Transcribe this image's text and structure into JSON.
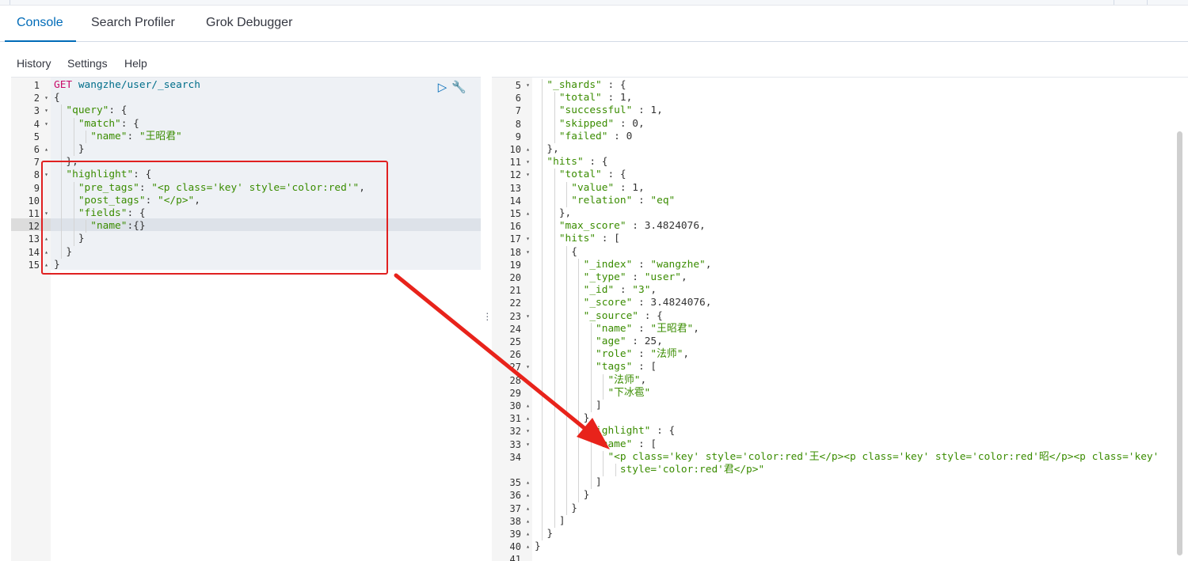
{
  "tabs": [
    {
      "label": "Console",
      "active": true
    },
    {
      "label": "Search Profiler",
      "active": false
    },
    {
      "label": "Grok Debugger",
      "active": false
    }
  ],
  "menu": [
    {
      "label": "History"
    },
    {
      "label": "Settings"
    },
    {
      "label": "Help"
    }
  ],
  "actions": {
    "run_icon": "play-icon",
    "settings_icon": "wrench-icon"
  },
  "colors": {
    "accent": "#006bb8",
    "annotation": "#e02020",
    "string": "#3a8c00",
    "method": "#c80a68"
  },
  "request": {
    "lines": [
      {
        "n": "1",
        "fold": "",
        "tokens": [
          {
            "t": "GET",
            "c": "method"
          },
          {
            "t": " ",
            "c": "p"
          },
          {
            "t": "wangzhe/user/_search",
            "c": "url"
          }
        ]
      },
      {
        "n": "2",
        "fold": "▾",
        "tokens": [
          {
            "t": "{",
            "c": "p"
          }
        ]
      },
      {
        "n": "3",
        "fold": "▾",
        "tokens": [
          {
            "t": "  ",
            "c": "p"
          },
          {
            "t": "\"query\"",
            "c": "key"
          },
          {
            "t": ": {",
            "c": "p"
          }
        ]
      },
      {
        "n": "4",
        "fold": "▾",
        "tokens": [
          {
            "t": "    ",
            "c": "p"
          },
          {
            "t": "\"match\"",
            "c": "key"
          },
          {
            "t": ": {",
            "c": "p"
          }
        ]
      },
      {
        "n": "5",
        "fold": "",
        "tokens": [
          {
            "t": "      ",
            "c": "p"
          },
          {
            "t": "\"name\"",
            "c": "key"
          },
          {
            "t": ": ",
            "c": "p"
          },
          {
            "t": "\"王昭君\"",
            "c": "str"
          }
        ]
      },
      {
        "n": "6",
        "fold": "▴",
        "tokens": [
          {
            "t": "    }",
            "c": "p"
          }
        ]
      },
      {
        "n": "7",
        "fold": "",
        "tokens": [
          {
            "t": "  },",
            "c": "p"
          }
        ]
      },
      {
        "n": "8",
        "fold": "▾",
        "tokens": [
          {
            "t": "  ",
            "c": "p"
          },
          {
            "t": "\"highlight\"",
            "c": "key"
          },
          {
            "t": ": {",
            "c": "p"
          }
        ]
      },
      {
        "n": "9",
        "fold": "",
        "tokens": [
          {
            "t": "    ",
            "c": "p"
          },
          {
            "t": "\"pre_tags\"",
            "c": "key"
          },
          {
            "t": ": ",
            "c": "p"
          },
          {
            "t": "\"<p class='key' style='color:red'\"",
            "c": "str"
          },
          {
            "t": ",",
            "c": "p"
          }
        ]
      },
      {
        "n": "10",
        "fold": "",
        "tokens": [
          {
            "t": "    ",
            "c": "p"
          },
          {
            "t": "\"post_tags\"",
            "c": "key"
          },
          {
            "t": ": ",
            "c": "p"
          },
          {
            "t": "\"</p>\"",
            "c": "str"
          },
          {
            "t": ",",
            "c": "p"
          }
        ]
      },
      {
        "n": "11",
        "fold": "▾",
        "tokens": [
          {
            "t": "    ",
            "c": "p"
          },
          {
            "t": "\"fields\"",
            "c": "key"
          },
          {
            "t": ": {",
            "c": "p"
          }
        ]
      },
      {
        "n": "12",
        "fold": "",
        "tokens": [
          {
            "t": "      ",
            "c": "p"
          },
          {
            "t": "\"name\"",
            "c": "key"
          },
          {
            "t": ":{}",
            "c": "p"
          }
        ]
      },
      {
        "n": "13",
        "fold": "▴",
        "tokens": [
          {
            "t": "    }",
            "c": "p"
          }
        ]
      },
      {
        "n": "14",
        "fold": "▴",
        "tokens": [
          {
            "t": "  }",
            "c": "p"
          }
        ]
      },
      {
        "n": "15",
        "fold": "▴",
        "tokens": [
          {
            "t": "}",
            "c": "p"
          }
        ]
      }
    ]
  },
  "response": {
    "lines": [
      {
        "n": "5",
        "fold": "▾",
        "tokens": [
          {
            "t": "  ",
            "c": "p"
          },
          {
            "t": "\"_shards\"",
            "c": "key"
          },
          {
            "t": " : {",
            "c": "p"
          }
        ]
      },
      {
        "n": "6",
        "fold": "",
        "tokens": [
          {
            "t": "    ",
            "c": "p"
          },
          {
            "t": "\"total\"",
            "c": "key"
          },
          {
            "t": " : 1,",
            "c": "p"
          }
        ]
      },
      {
        "n": "7",
        "fold": "",
        "tokens": [
          {
            "t": "    ",
            "c": "p"
          },
          {
            "t": "\"successful\"",
            "c": "key"
          },
          {
            "t": " : 1,",
            "c": "p"
          }
        ]
      },
      {
        "n": "8",
        "fold": "",
        "tokens": [
          {
            "t": "    ",
            "c": "p"
          },
          {
            "t": "\"skipped\"",
            "c": "key"
          },
          {
            "t": " : 0,",
            "c": "p"
          }
        ]
      },
      {
        "n": "9",
        "fold": "",
        "tokens": [
          {
            "t": "    ",
            "c": "p"
          },
          {
            "t": "\"failed\"",
            "c": "key"
          },
          {
            "t": " : 0",
            "c": "p"
          }
        ]
      },
      {
        "n": "10",
        "fold": "▴",
        "tokens": [
          {
            "t": "  },",
            "c": "p"
          }
        ]
      },
      {
        "n": "11",
        "fold": "▾",
        "tokens": [
          {
            "t": "  ",
            "c": "p"
          },
          {
            "t": "\"hits\"",
            "c": "key"
          },
          {
            "t": " : {",
            "c": "p"
          }
        ]
      },
      {
        "n": "12",
        "fold": "▾",
        "tokens": [
          {
            "t": "    ",
            "c": "p"
          },
          {
            "t": "\"total\"",
            "c": "key"
          },
          {
            "t": " : {",
            "c": "p"
          }
        ]
      },
      {
        "n": "13",
        "fold": "",
        "tokens": [
          {
            "t": "      ",
            "c": "p"
          },
          {
            "t": "\"value\"",
            "c": "key"
          },
          {
            "t": " : 1,",
            "c": "p"
          }
        ]
      },
      {
        "n": "14",
        "fold": "",
        "tokens": [
          {
            "t": "      ",
            "c": "p"
          },
          {
            "t": "\"relation\"",
            "c": "key"
          },
          {
            "t": " : ",
            "c": "p"
          },
          {
            "t": "\"eq\"",
            "c": "str"
          }
        ]
      },
      {
        "n": "15",
        "fold": "▴",
        "tokens": [
          {
            "t": "    },",
            "c": "p"
          }
        ]
      },
      {
        "n": "16",
        "fold": "",
        "tokens": [
          {
            "t": "    ",
            "c": "p"
          },
          {
            "t": "\"max_score\"",
            "c": "key"
          },
          {
            "t": " : 3.4824076,",
            "c": "p"
          }
        ]
      },
      {
        "n": "17",
        "fold": "▾",
        "tokens": [
          {
            "t": "    ",
            "c": "p"
          },
          {
            "t": "\"hits\"",
            "c": "key"
          },
          {
            "t": " : [",
            "c": "p"
          }
        ]
      },
      {
        "n": "18",
        "fold": "▾",
        "tokens": [
          {
            "t": "      {",
            "c": "p"
          }
        ]
      },
      {
        "n": "19",
        "fold": "",
        "tokens": [
          {
            "t": "        ",
            "c": "p"
          },
          {
            "t": "\"_index\"",
            "c": "key"
          },
          {
            "t": " : ",
            "c": "p"
          },
          {
            "t": "\"wangzhe\"",
            "c": "str"
          },
          {
            "t": ",",
            "c": "p"
          }
        ]
      },
      {
        "n": "20",
        "fold": "",
        "tokens": [
          {
            "t": "        ",
            "c": "p"
          },
          {
            "t": "\"_type\"",
            "c": "key"
          },
          {
            "t": " : ",
            "c": "p"
          },
          {
            "t": "\"user\"",
            "c": "str"
          },
          {
            "t": ",",
            "c": "p"
          }
        ]
      },
      {
        "n": "21",
        "fold": "",
        "tokens": [
          {
            "t": "        ",
            "c": "p"
          },
          {
            "t": "\"_id\"",
            "c": "key"
          },
          {
            "t": " : ",
            "c": "p"
          },
          {
            "t": "\"3\"",
            "c": "str"
          },
          {
            "t": ",",
            "c": "p"
          }
        ]
      },
      {
        "n": "22",
        "fold": "",
        "tokens": [
          {
            "t": "        ",
            "c": "p"
          },
          {
            "t": "\"_score\"",
            "c": "key"
          },
          {
            "t": " : 3.4824076,",
            "c": "p"
          }
        ]
      },
      {
        "n": "23",
        "fold": "▾",
        "tokens": [
          {
            "t": "        ",
            "c": "p"
          },
          {
            "t": "\"_source\"",
            "c": "key"
          },
          {
            "t": " : {",
            "c": "p"
          }
        ]
      },
      {
        "n": "24",
        "fold": "",
        "tokens": [
          {
            "t": "          ",
            "c": "p"
          },
          {
            "t": "\"name\"",
            "c": "key"
          },
          {
            "t": " : ",
            "c": "p"
          },
          {
            "t": "\"王昭君\"",
            "c": "str"
          },
          {
            "t": ",",
            "c": "p"
          }
        ]
      },
      {
        "n": "25",
        "fold": "",
        "tokens": [
          {
            "t": "          ",
            "c": "p"
          },
          {
            "t": "\"age\"",
            "c": "key"
          },
          {
            "t": " : 25,",
            "c": "p"
          }
        ]
      },
      {
        "n": "26",
        "fold": "",
        "tokens": [
          {
            "t": "          ",
            "c": "p"
          },
          {
            "t": "\"role\"",
            "c": "key"
          },
          {
            "t": " : ",
            "c": "p"
          },
          {
            "t": "\"法师\"",
            "c": "str"
          },
          {
            "t": ",",
            "c": "p"
          }
        ]
      },
      {
        "n": "27",
        "fold": "▾",
        "tokens": [
          {
            "t": "          ",
            "c": "p"
          },
          {
            "t": "\"tags\"",
            "c": "key"
          },
          {
            "t": " : [",
            "c": "p"
          }
        ]
      },
      {
        "n": "28",
        "fold": "",
        "tokens": [
          {
            "t": "            ",
            "c": "p"
          },
          {
            "t": "\"法师\"",
            "c": "str"
          },
          {
            "t": ",",
            "c": "p"
          }
        ]
      },
      {
        "n": "29",
        "fold": "",
        "tokens": [
          {
            "t": "            ",
            "c": "p"
          },
          {
            "t": "\"下冰雹\"",
            "c": "str"
          }
        ]
      },
      {
        "n": "30",
        "fold": "▴",
        "tokens": [
          {
            "t": "          ]",
            "c": "p"
          }
        ]
      },
      {
        "n": "31",
        "fold": "▴",
        "tokens": [
          {
            "t": "        },",
            "c": "p"
          }
        ]
      },
      {
        "n": "32",
        "fold": "▾",
        "tokens": [
          {
            "t": "        ",
            "c": "p"
          },
          {
            "t": "\"highlight\"",
            "c": "key"
          },
          {
            "t": " : {",
            "c": "p"
          }
        ]
      },
      {
        "n": "33",
        "fold": "▾",
        "tokens": [
          {
            "t": "          ",
            "c": "p"
          },
          {
            "t": "\"name\"",
            "c": "key"
          },
          {
            "t": " : [",
            "c": "p"
          }
        ]
      },
      {
        "n": "34",
        "fold": "",
        "tokens": [
          {
            "t": "            ",
            "c": "p"
          },
          {
            "t": "\"<p class='key' style='color:red'王</p><p class='key' style='color:red'昭</p><p class='key'",
            "c": "str"
          }
        ]
      },
      {
        "n": "",
        "fold": "",
        "tokens": [
          {
            "t": "              ",
            "c": "p"
          },
          {
            "t": "style='color:red'君</p>\"",
            "c": "str"
          }
        ]
      },
      {
        "n": "35",
        "fold": "▴",
        "tokens": [
          {
            "t": "          ]",
            "c": "p"
          }
        ]
      },
      {
        "n": "36",
        "fold": "▴",
        "tokens": [
          {
            "t": "        }",
            "c": "p"
          }
        ]
      },
      {
        "n": "37",
        "fold": "▴",
        "tokens": [
          {
            "t": "      }",
            "c": "p"
          }
        ]
      },
      {
        "n": "38",
        "fold": "▴",
        "tokens": [
          {
            "t": "    ]",
            "c": "p"
          }
        ]
      },
      {
        "n": "39",
        "fold": "▴",
        "tokens": [
          {
            "t": "  }",
            "c": "p"
          }
        ]
      },
      {
        "n": "40",
        "fold": "▴",
        "tokens": [
          {
            "t": "}",
            "c": "p"
          }
        ]
      },
      {
        "n": "41",
        "fold": "",
        "tokens": []
      }
    ]
  }
}
